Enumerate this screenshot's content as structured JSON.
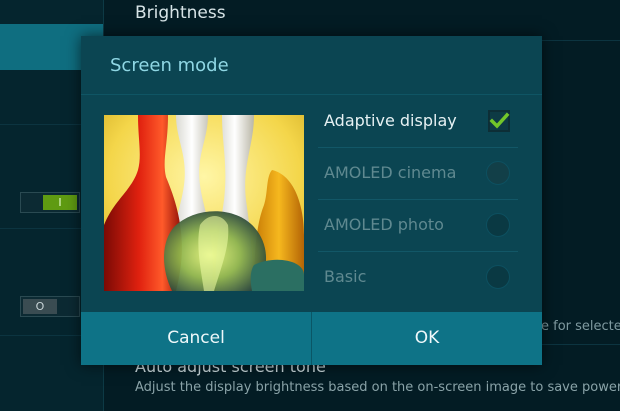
{
  "background": {
    "title": "Brightness",
    "toggles": [
      {
        "label": "I",
        "state": "on"
      },
      {
        "label": "O",
        "state": "off"
      }
    ],
    "side_text": "e for selected",
    "bottom_item": {
      "title": "Auto adjust screen tone",
      "subtitle": "Adjust the display brightness based on the on-screen image to save power."
    }
  },
  "dialog": {
    "title": "Screen mode",
    "preview_icon": "glass-vases-image",
    "options": [
      {
        "label": "Adaptive display",
        "control": "checkbox",
        "checked": true,
        "enabled": true
      },
      {
        "label": "AMOLED cinema",
        "control": "radio",
        "checked": false,
        "enabled": false
      },
      {
        "label": "AMOLED photo",
        "control": "radio",
        "checked": false,
        "enabled": false
      },
      {
        "label": "Basic",
        "control": "radio",
        "checked": false,
        "enabled": false
      }
    ],
    "buttons": {
      "cancel": "Cancel",
      "ok": "OK"
    }
  },
  "colors": {
    "accent": "#0e7387",
    "dialog_bg": "#0b4552",
    "title": "#8fd7e4",
    "check": "#72c62a"
  }
}
